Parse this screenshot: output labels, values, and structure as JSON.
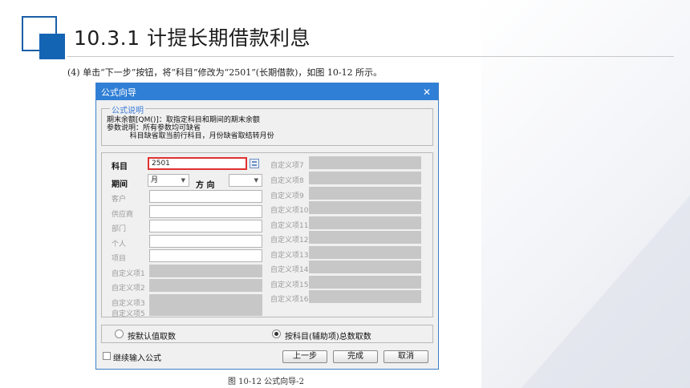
{
  "slide": {
    "title": "10.3.1  计提长期借款利息",
    "caption": "(4) 单击“下一步”按钮，将“科目”修改为“2501”(长期借款)，如图 10-12 所示。",
    "figure_caption": "图 10-12  公式向导-2"
  },
  "dialog": {
    "title": "公式向导",
    "close_icon": "close-icon",
    "description": {
      "legend": "公式说明",
      "text": "期末余额[QM()]：取指定科目和期间的期末余额\n参数说明：所有参数均可缺省\n          科目缺省取当前行科目，月份缺省取结转月份"
    },
    "fields": {
      "subject_label": "科目",
      "subject_value": "2501",
      "period_label": "期间",
      "period_value": "月",
      "direction_label": "方 向",
      "direction_value": "",
      "customer_label": "客户",
      "supplier_label": "供应商",
      "dept_label": "部门",
      "person_label": "个人",
      "project_label": "项目",
      "custom_left": [
        "自定义项1",
        "自定义项2",
        "自定义项3",
        "自定义项5"
      ],
      "custom_right": [
        "自定义项7",
        "自定义项8",
        "自定义项9",
        "自定义项10",
        "自定义项11",
        "自定义项12",
        "自定义项13",
        "自定义项14",
        "自定义项15",
        "自定义项16"
      ]
    },
    "radios": {
      "default_label": "按默认值取数",
      "by_subject_label": "按科目(辅助项)总数取数",
      "selected": "by_subject"
    },
    "continue_label": "继续输入公式",
    "buttons": {
      "prev": "上一步",
      "finish": "完成",
      "cancel": "取消"
    }
  },
  "colors": {
    "title_bar": "#2f7fd6",
    "accent": "#1464b4",
    "highlight": "#e03030"
  }
}
